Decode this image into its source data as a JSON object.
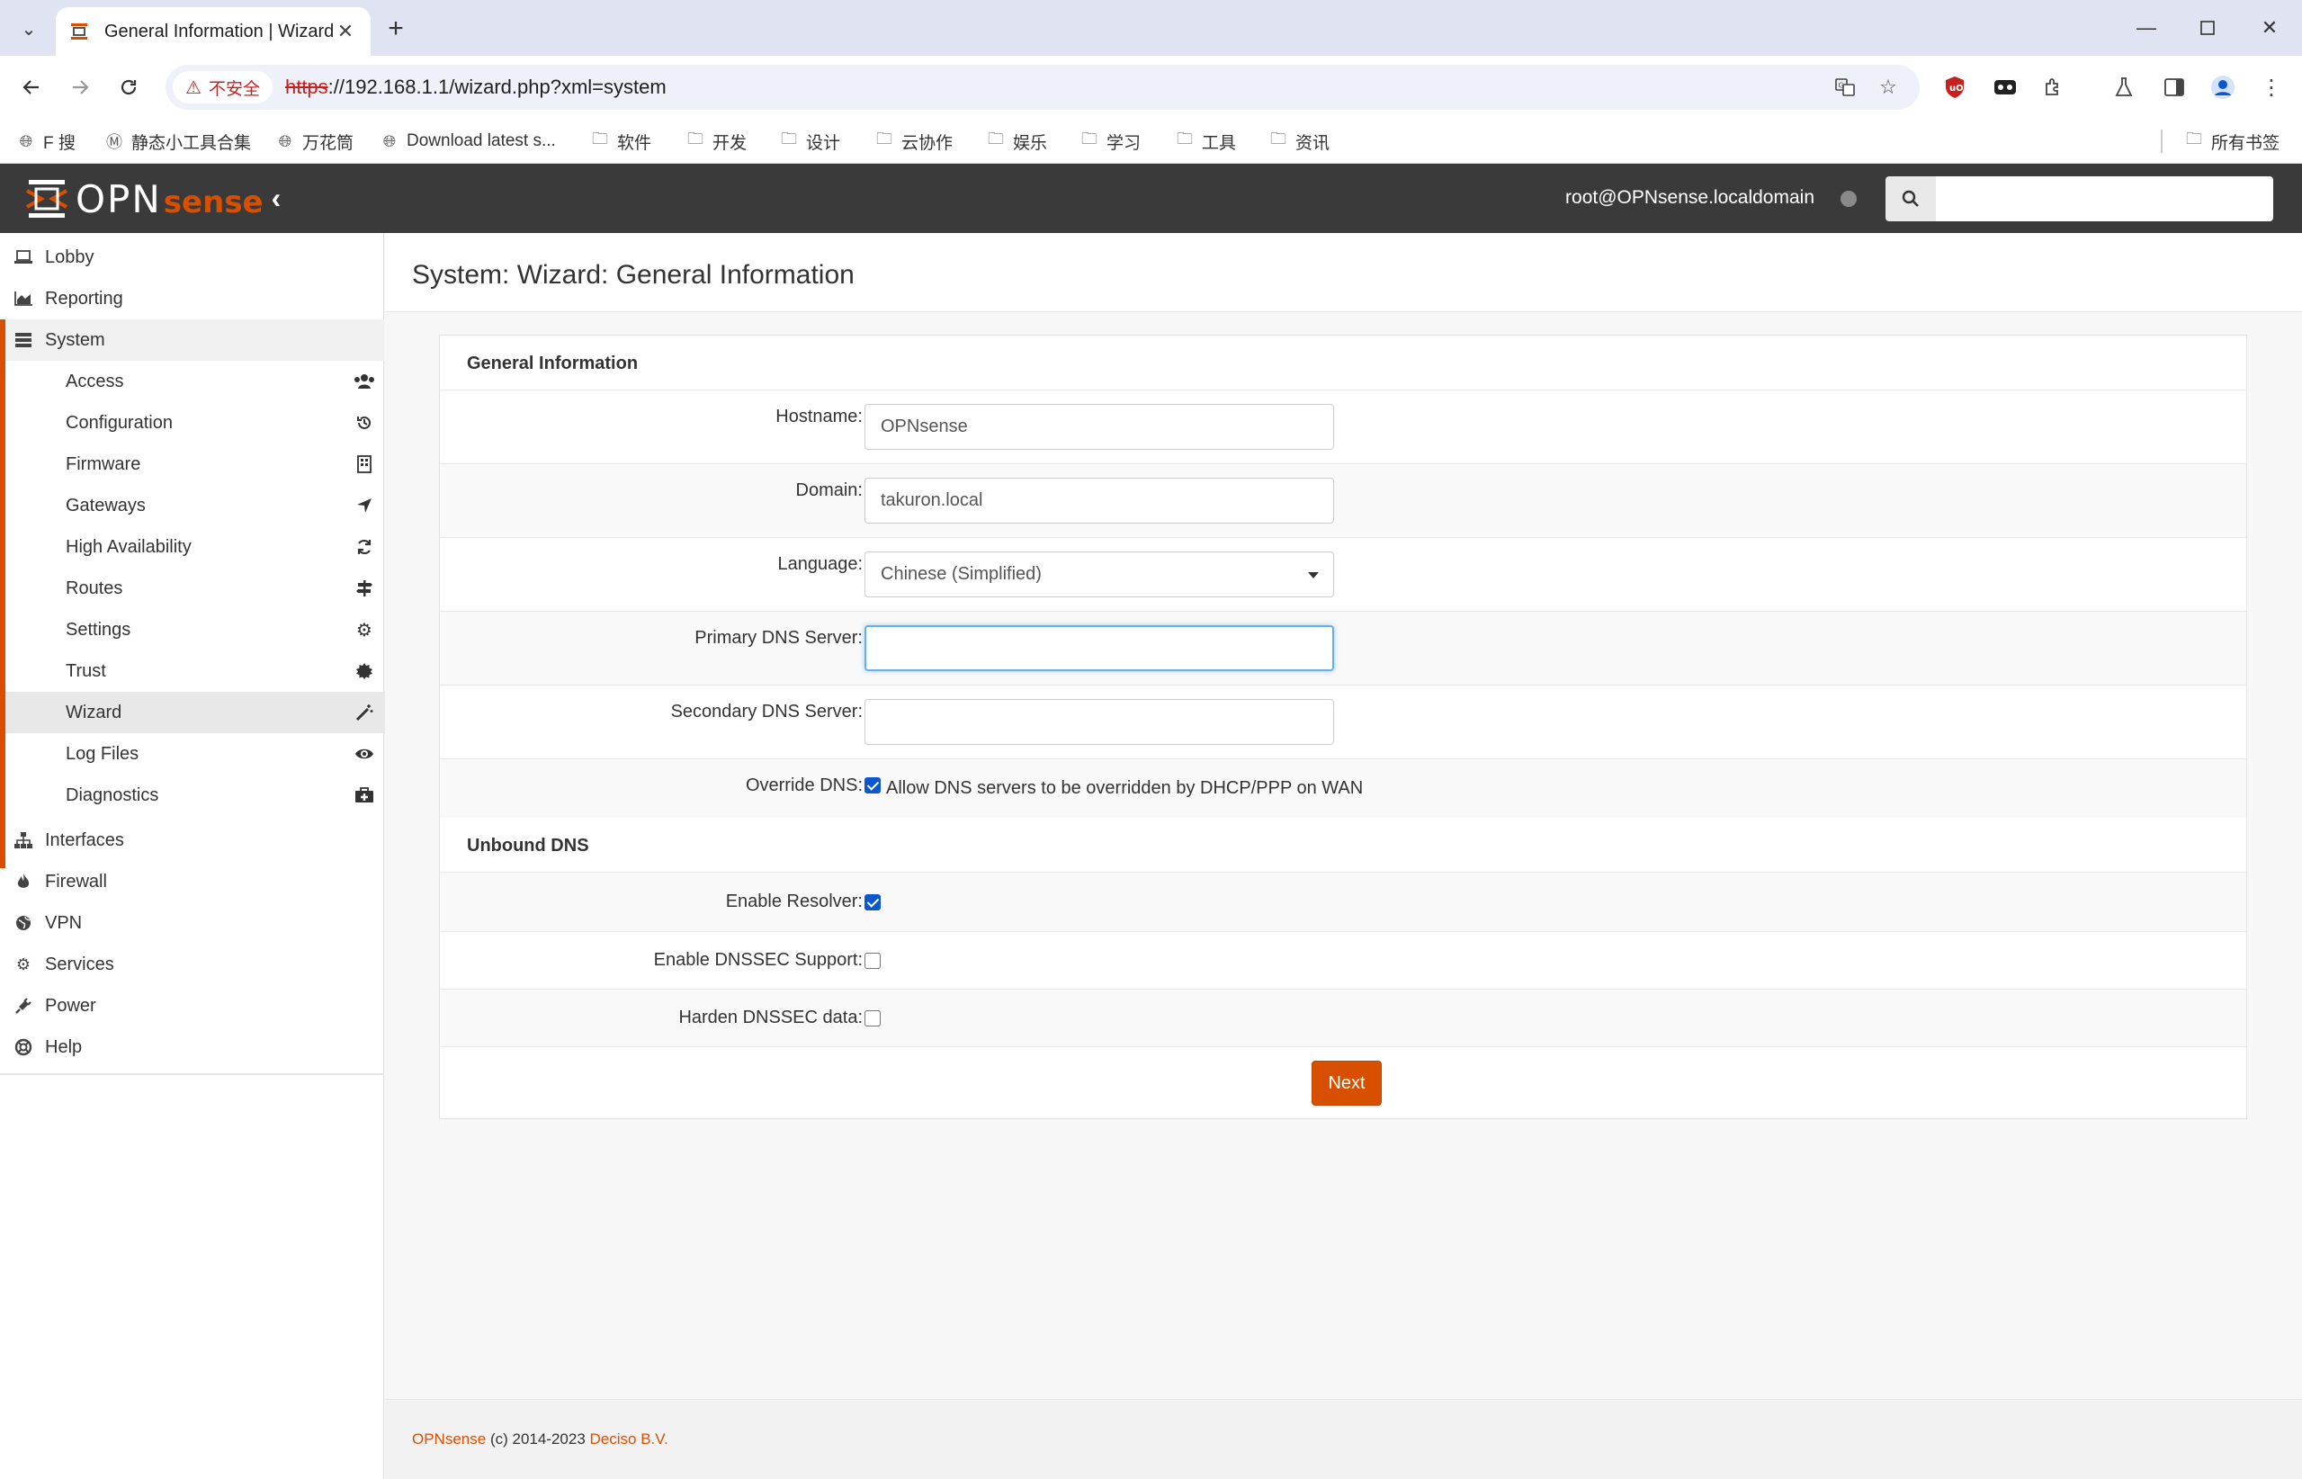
{
  "browser": {
    "tab_title": "General Information | Wizard",
    "insecure_label": "不安全",
    "url_scheme": "https",
    "url_rest": "://192.168.1.1/wizard.php?xml=system",
    "bookmarks": [
      {
        "label": "F 搜",
        "icon": "globe-icon"
      },
      {
        "label": "静态小工具合集",
        "icon": "circle-m-icon"
      },
      {
        "label": "万花筒",
        "icon": "globe-icon"
      },
      {
        "label": "Download latest s...",
        "icon": "globe-icon"
      },
      {
        "label": "软件",
        "icon": "folder-icon"
      },
      {
        "label": "开发",
        "icon": "folder-icon"
      },
      {
        "label": "设计",
        "icon": "folder-icon"
      },
      {
        "label": "云协作",
        "icon": "folder-icon"
      },
      {
        "label": "娱乐",
        "icon": "folder-icon"
      },
      {
        "label": "学习",
        "icon": "folder-icon"
      },
      {
        "label": "工具",
        "icon": "folder-icon"
      },
      {
        "label": "资讯",
        "icon": "folder-icon"
      }
    ],
    "all_bookmarks": "所有书签"
  },
  "header": {
    "logo_opn": "OPN",
    "logo_sense": "sense",
    "user": "root@OPNsense.localdomain",
    "search_placeholder": ""
  },
  "sidebar": {
    "top_items": [
      {
        "label": "Lobby",
        "icon": "laptop-icon"
      },
      {
        "label": "Reporting",
        "icon": "area-chart-icon"
      },
      {
        "label": "System",
        "icon": "server-icon"
      }
    ],
    "system_items": [
      {
        "label": "Access",
        "icon": "users-icon"
      },
      {
        "label": "Configuration",
        "icon": "history-icon"
      },
      {
        "label": "Firmware",
        "icon": "building-icon"
      },
      {
        "label": "Gateways",
        "icon": "location-arrow-icon"
      },
      {
        "label": "High Availability",
        "icon": "refresh-icon"
      },
      {
        "label": "Routes",
        "icon": "map-signs-icon"
      },
      {
        "label": "Settings",
        "icon": "cogs-icon"
      },
      {
        "label": "Trust",
        "icon": "certificate-icon"
      },
      {
        "label": "Wizard",
        "icon": "magic-icon"
      },
      {
        "label": "Log Files",
        "icon": "eye-icon"
      },
      {
        "label": "Diagnostics",
        "icon": "medkit-icon"
      }
    ],
    "bottom_items": [
      {
        "label": "Interfaces",
        "icon": "sitemap-icon"
      },
      {
        "label": "Firewall",
        "icon": "fire-icon"
      },
      {
        "label": "VPN",
        "icon": "globe-icon"
      },
      {
        "label": "Services",
        "icon": "cog-icon"
      },
      {
        "label": "Power",
        "icon": "plug-icon"
      },
      {
        "label": "Help",
        "icon": "life-ring-icon"
      }
    ]
  },
  "page": {
    "title": "System: Wizard: General Information",
    "section_general": "General Information",
    "hostname_label": "Hostname:",
    "hostname_value": "OPNsense",
    "domain_label": "Domain:",
    "domain_value": "takuron.local",
    "language_label": "Language:",
    "language_value": "Chinese (Simplified)",
    "dns1_label": "Primary DNS Server:",
    "dns1_value": "",
    "dns2_label": "Secondary DNS Server:",
    "dns2_value": "",
    "override_label": "Override DNS:",
    "override_text": "Allow DNS servers to be overridden by DHCP/PPP on WAN",
    "override_checked": true,
    "section_unbound": "Unbound DNS",
    "resolver_label": "Enable Resolver:",
    "resolver_checked": true,
    "dnssec_label": "Enable DNSSEC Support:",
    "dnssec_checked": false,
    "harden_label": "Harden DNSSEC data:",
    "harden_checked": false,
    "next_button": "Next"
  },
  "footer": {
    "brand": "OPNsense",
    "copyright": "(c) 2014-2023",
    "company": "Deciso B.V."
  },
  "colors": {
    "accent": "#d94f00",
    "header_bg": "#3a3a3a",
    "focus_border": "#66afe9",
    "checkbox_blue": "#0b57d0"
  }
}
